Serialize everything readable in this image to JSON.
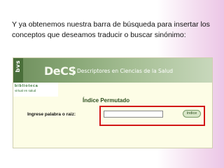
{
  "slide": {
    "caption": "Y ya obtenemos nuestra barra de búsqueda para insertar los conceptos que deseamos traducir o buscar sinónimo:"
  },
  "screenshot": {
    "logo": "bvs",
    "brand_line1": "biblioteca",
    "brand_line2": "virtual en salud",
    "decs_mark": "DeCS",
    "decs_subtitle": "Descriptores en Ciencias de la Salud",
    "page_title": "Índice Permutado",
    "search": {
      "label": "Ingrese palabra o raiz:",
      "value": "",
      "button_label": "índice"
    }
  },
  "colors": {
    "banner_green": "#88a776",
    "highlight_red": "#d21818",
    "panel_bg": "#fdfde6"
  }
}
